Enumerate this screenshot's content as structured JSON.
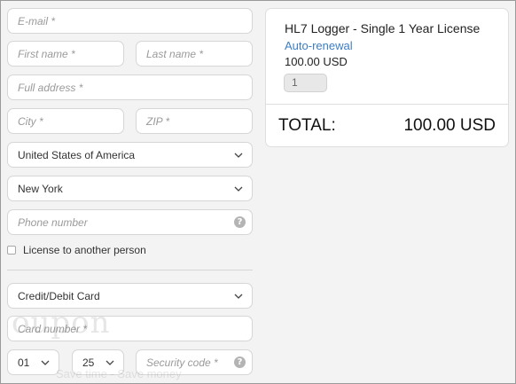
{
  "form": {
    "email": {
      "placeholder": "E-mail *"
    },
    "first_name": {
      "placeholder": "First name *"
    },
    "last_name": {
      "placeholder": "Last name *"
    },
    "address": {
      "placeholder": "Full address *"
    },
    "city": {
      "placeholder": "City *"
    },
    "zip": {
      "placeholder": "ZIP *"
    },
    "country": {
      "value": "United States of America"
    },
    "state": {
      "value": "New York"
    },
    "phone": {
      "placeholder": "Phone number",
      "help": "?"
    },
    "license_other": {
      "label": "License to another person",
      "checked": false
    },
    "payment_method": {
      "value": "Credit/Debit Card"
    },
    "card_number": {
      "placeholder": "Card number *"
    },
    "exp_month": {
      "value": "01"
    },
    "exp_year": {
      "value": "25"
    },
    "security_code": {
      "placeholder": "Security code *",
      "help": "?"
    }
  },
  "summary": {
    "product": "HL7 Logger - Single 1 Year License",
    "renewal": "Auto-renewal",
    "price": "100.00 USD",
    "quantity": "1",
    "total_label": "TOTAL:",
    "total_value": "100.00 USD"
  },
  "watermark": {
    "logo": "oupon",
    "tagline": "Save time - Save money"
  },
  "colors": {
    "link": "#3c7dc4",
    "border": "#d6d6d6",
    "background": "#f3f3f3"
  }
}
